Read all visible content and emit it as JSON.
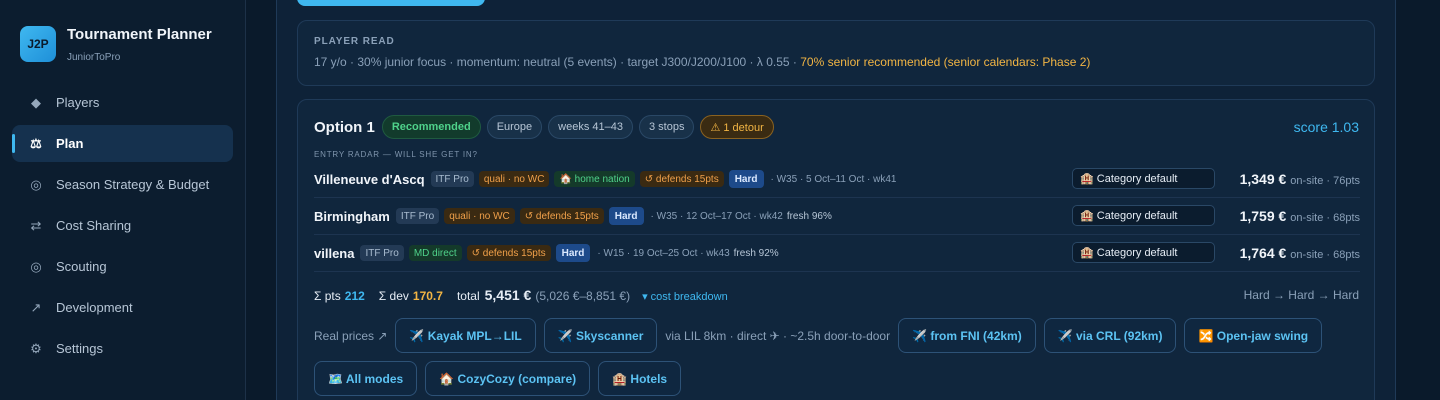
{
  "app": {
    "logo": "J2P",
    "title": "Tournament Planner",
    "subtitle": "JuniorToPro"
  },
  "nav": [
    {
      "icon": "◆",
      "icon_name": "diamond-icon",
      "label": "Players"
    },
    {
      "icon": "⚖",
      "icon_name": "scale-icon",
      "label": "Plan",
      "active": true
    },
    {
      "icon": "◎",
      "icon_name": "target-icon",
      "label": "Season Strategy & Budget"
    },
    {
      "icon": "⇄",
      "icon_name": "swap-icon",
      "label": "Cost Sharing"
    },
    {
      "icon": "◎",
      "icon_name": "target-icon",
      "label": "Scouting"
    },
    {
      "icon": "↗",
      "icon_name": "trend-arrow-icon",
      "label": "Development"
    },
    {
      "icon": "⚙",
      "icon_name": "gear-icon",
      "label": "Settings"
    }
  ],
  "player_read": {
    "title": "PLAYER READ",
    "text": "17 y/o · 30% junior focus · momentum: neutral (5 events) · target J300/J200/J100 · λ 0.55 · ",
    "warning": "70% senior recommended (senior calendars: Phase 2)"
  },
  "option": {
    "title": "Option 1",
    "chips": {
      "recommended": "Recommended",
      "region": "Europe",
      "weeks": "weeks 41–43",
      "stops": "3 stops",
      "detour": "⚠ 1 detour"
    },
    "score": "score 1.03",
    "radar_label": "ENTRY RADAR — WILL SHE GET IN?",
    "rows": [
      {
        "name": "Villeneuve d'Ascq",
        "category": "ITF Pro",
        "entry": "quali · no WC",
        "extra": "🏠 home nation",
        "defends": "↺ defends 15pts",
        "surface": "Hard",
        "meta": "· W35 · 5 Oct–11 Oct · wk41",
        "fresh": "",
        "hotel": "🏨 Category default",
        "price": "1,349 €",
        "price_meta": "on-site · 76pts"
      },
      {
        "name": "Birmingham",
        "category": "ITF Pro",
        "entry": "quali · no WC",
        "extra": "",
        "defends": "↺ defends 15pts",
        "surface": "Hard",
        "meta": "· W35 · 12 Oct–17 Oct · wk42",
        "fresh": "fresh 96%",
        "hotel": "🏨 Category default",
        "price": "1,759 €",
        "price_meta": "on-site · 68pts"
      },
      {
        "name": "villena",
        "category": "ITF Pro",
        "entry": "MD direct",
        "extra": "",
        "defends": "↺ defends 15pts",
        "surface": "Hard",
        "meta": "· W15 · 19 Oct–25 Oct · wk43",
        "fresh": "fresh 92%",
        "hotel": "🏨 Category default",
        "price": "1,764 €",
        "price_meta": "on-site · 68pts"
      }
    ],
    "summary": {
      "pts_label": "Σ pts",
      "pts": "212",
      "dev_label": "Σ dev",
      "dev": "170.7",
      "total_label": "total",
      "total": "5,451 €",
      "range": "(5,026 €–8,851 €)",
      "cost_link": "▾ cost breakdown",
      "surface_path": "Hard → Hard → Hard"
    },
    "links": {
      "prices_label": "Real prices ↗",
      "kayak": "✈️ Kayak MPL→LIL",
      "skyscanner": "✈️ Skyscanner",
      "via_note": "via LIL 8km · direct ✈ · ~2.5h door-to-door",
      "fni": "✈️ from FNI (42km)",
      "crl": "✈️ via CRL (92km)",
      "openjaw": "🔀 Open-jaw swing",
      "allmodes": "🗺️ All modes",
      "cozycozy": "🏠 CozyCozy (compare)",
      "hotels": "🏨 Hotels"
    }
  },
  "colors": {
    "accent": "#3fb8f0",
    "warning": "#f2b544",
    "success": "#4fd28a",
    "background": "#0a1a2b"
  }
}
